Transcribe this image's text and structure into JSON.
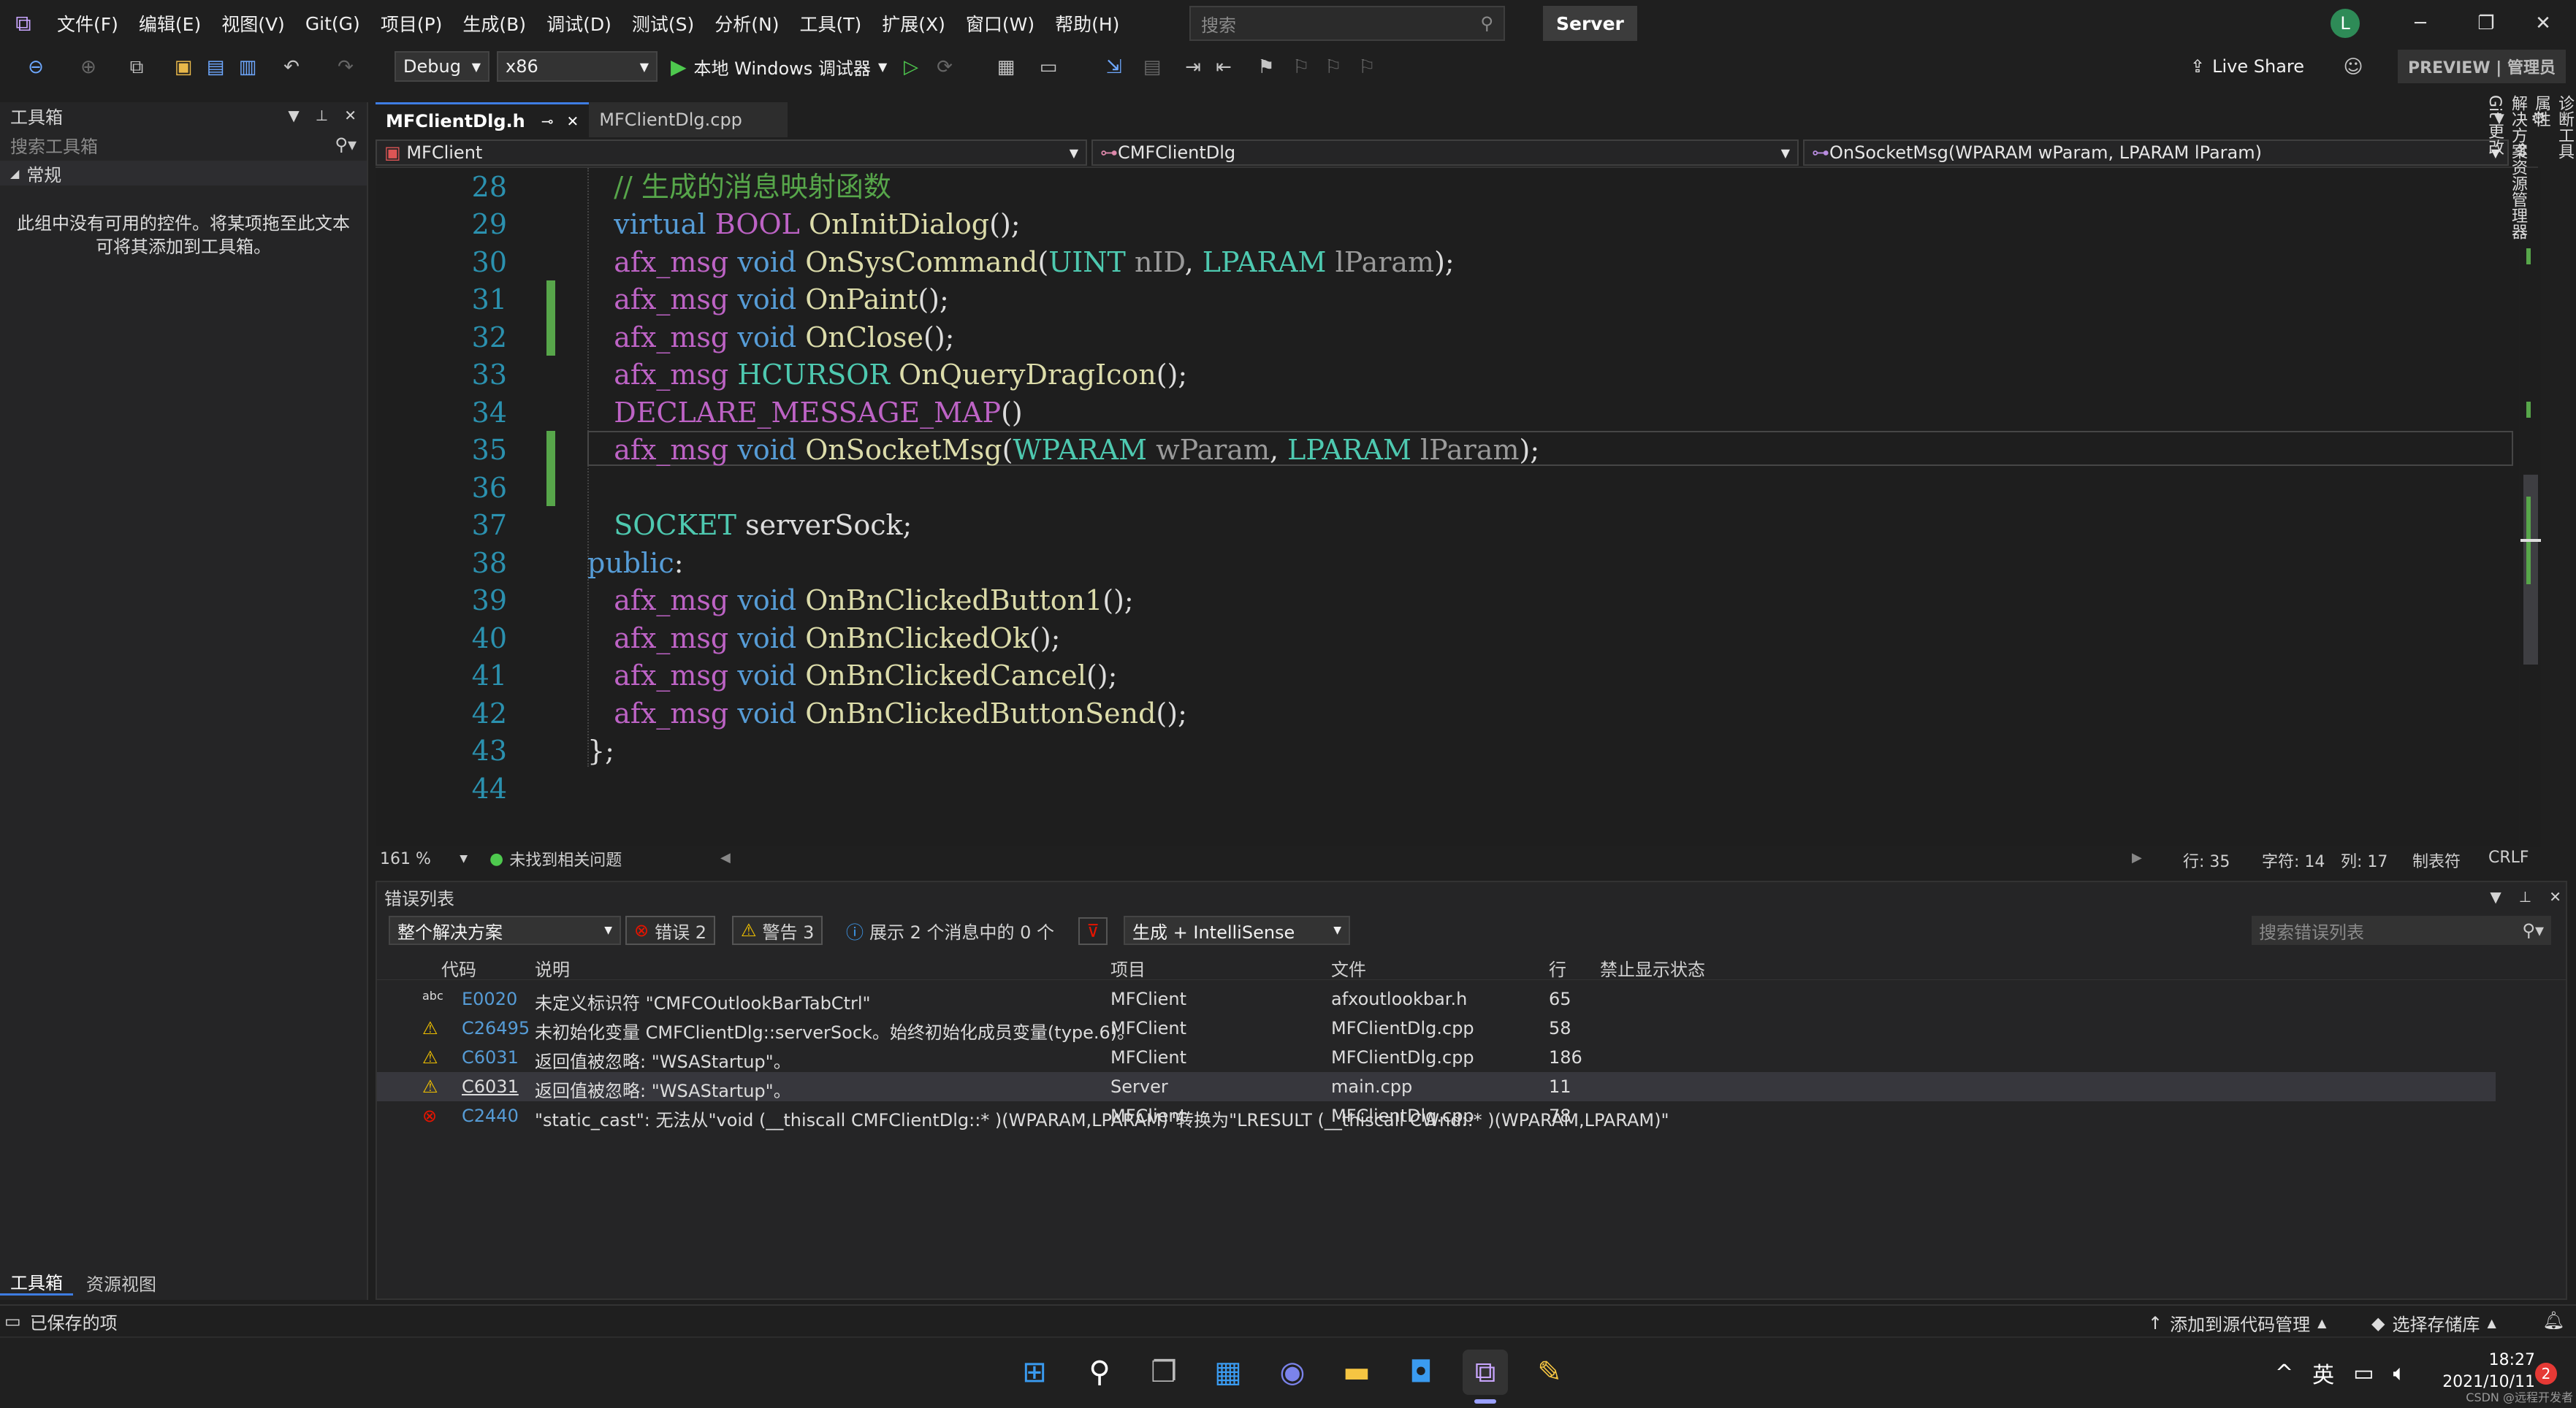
{
  "menu": [
    "文件(F)",
    "编辑(E)",
    "视图(V)",
    "Git(G)",
    "项目(P)",
    "生成(B)",
    "调试(D)",
    "测试(S)",
    "分析(N)",
    "工具(T)",
    "扩展(X)",
    "窗口(W)",
    "帮助(H)"
  ],
  "search_placeholder": "搜索",
  "solution_name": "Server",
  "user_initial": "L",
  "toolbar": {
    "config": "Debug",
    "platform": "x86",
    "run_label": "本地 Windows 调试器",
    "live_share": "Live Share",
    "preview": "PREVIEW | 管理员"
  },
  "toolbox": {
    "title": "工具箱",
    "search_placeholder": "搜索工具箱",
    "group": "常规",
    "empty_text_1": "此组中没有可用的控件。将某项拖至此文本",
    "empty_text_2": "可将其添加到工具箱。",
    "tab_toolbox": "工具箱",
    "tab_resources": "资源视图"
  },
  "editor": {
    "tabs": [
      {
        "label": "MFClientDlg.h"
      },
      {
        "label": "MFClientDlg.cpp"
      }
    ],
    "nav_project": "MFClient",
    "nav_class": "CMFClientDlg",
    "nav_member": "OnSocketMsg(WPARAM wParam, LPARAM lParam)",
    "line_numbers": [
      "28",
      "29",
      "30",
      "31",
      "32",
      "33",
      "34",
      "35",
      "36",
      "37",
      "38",
      "39",
      "40",
      "41",
      "42",
      "43",
      "44"
    ]
  },
  "editor_status": {
    "zoom": "161 %",
    "issues": "未找到相关问题",
    "line": "行: 35",
    "char": "字符: 14",
    "col": "列: 17",
    "tabs": "制表符",
    "eol": "CRLF"
  },
  "error_list": {
    "title": "错误列表",
    "scope": "整个解决方案",
    "errors_btn": "错误 2",
    "warnings_btn": "警告 3",
    "messages_btn": "展示 2 个消息中的 0 个",
    "source": "生成 + IntelliSense",
    "search_placeholder": "搜索错误列表",
    "columns": {
      "code": "代码",
      "desc": "说明",
      "project": "项目",
      "file": "文件",
      "line": "行",
      "suppress": "禁止显示状态"
    },
    "rows": [
      {
        "icon": "abc",
        "code": "E0020",
        "desc": "未定义标识符 \"CMFCOutlookBarTabCtrl\"",
        "project": "MFClient",
        "file": "afxoutlookbar.h",
        "line": "65"
      },
      {
        "icon": "warning",
        "code": "C26495",
        "desc": "未初始化变量 CMFClientDlg::serverSock。始终初始化成员变量(type.6)。",
        "project": "MFClient",
        "file": "MFClientDlg.cpp",
        "line": "58"
      },
      {
        "icon": "warning",
        "code": "C6031",
        "desc": "返回值被忽略: \"WSAStartup\"。",
        "project": "MFClient",
        "file": "MFClientDlg.cpp",
        "line": "186"
      },
      {
        "icon": "warning",
        "code": "C6031",
        "desc": "返回值被忽略: \"WSAStartup\"。",
        "project": "Server",
        "file": "main.cpp",
        "line": "11"
      },
      {
        "icon": "error",
        "code": "C2440",
        "desc": "\"static_cast\": 无法从\"void (__thiscall CMFClientDlg::* )(WPARAM,LPARAM)\"转换为\"LRESULT (__thiscall CWnd::* )(WPARAM,LPARAM)\"",
        "project": "MFClient",
        "file": "MFClientDlg.cpp",
        "line": "78"
      }
    ]
  },
  "right_strip": [
    "诊断工具",
    "属性",
    "解决方案资源管理器",
    "Git 更改"
  ],
  "statusbar": {
    "saved": "已保存的项",
    "add_source": "添加到源代码管理",
    "select_repo": "选择存储库"
  },
  "taskbar": {
    "ime": "英",
    "time": "18:27",
    "date": "2021/10/11",
    "notif_count": "2",
    "watermark": "CSDN @远程开发者"
  }
}
